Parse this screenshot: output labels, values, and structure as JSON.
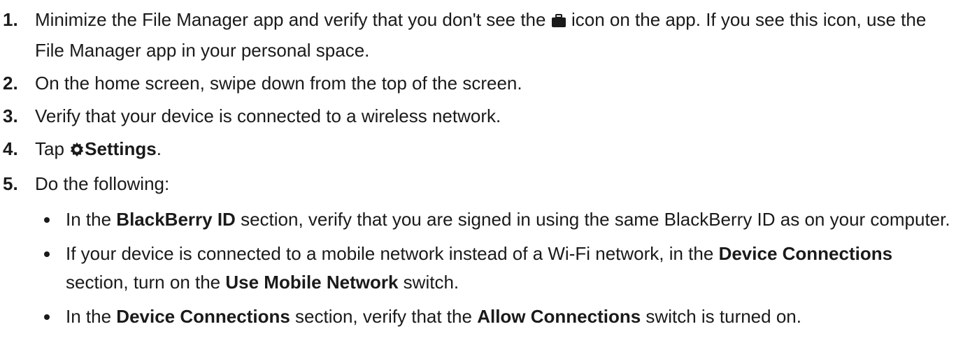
{
  "steps": [
    {
      "num": "1.",
      "t1": "Minimize the File Manager app and verify that you don't see the",
      "icon": "briefcase-icon",
      "t2": "icon on the app. If you see this icon, use the File Manager app in your personal space."
    },
    {
      "num": "2.",
      "text": "On the home screen, swipe down from the top of the screen."
    },
    {
      "num": "3.",
      "text": "Verify that your device is connected to a wireless network."
    },
    {
      "num": "4.",
      "pre": "Tap",
      "icon": "gear-icon",
      "bold": "Settings",
      "post": "."
    },
    {
      "num": "5.",
      "text": "Do the following:",
      "bullets": [
        {
          "t1": "In the",
          "b1": "BlackBerry ID",
          "t2": "section, verify that you are signed in using the same BlackBerry ID as on your computer."
        },
        {
          "t1": "If your device is connected to a mobile network instead of a Wi-Fi network, in the",
          "b1": "Device Connections",
          "t2": "section, turn on the",
          "b2": "Use Mobile Network",
          "t3": "switch."
        },
        {
          "t1": "In the",
          "b1": "Device Connections",
          "t2": "section, verify that the",
          "b2": "Allow Connections",
          "t3": "switch is turned on."
        }
      ]
    }
  ]
}
